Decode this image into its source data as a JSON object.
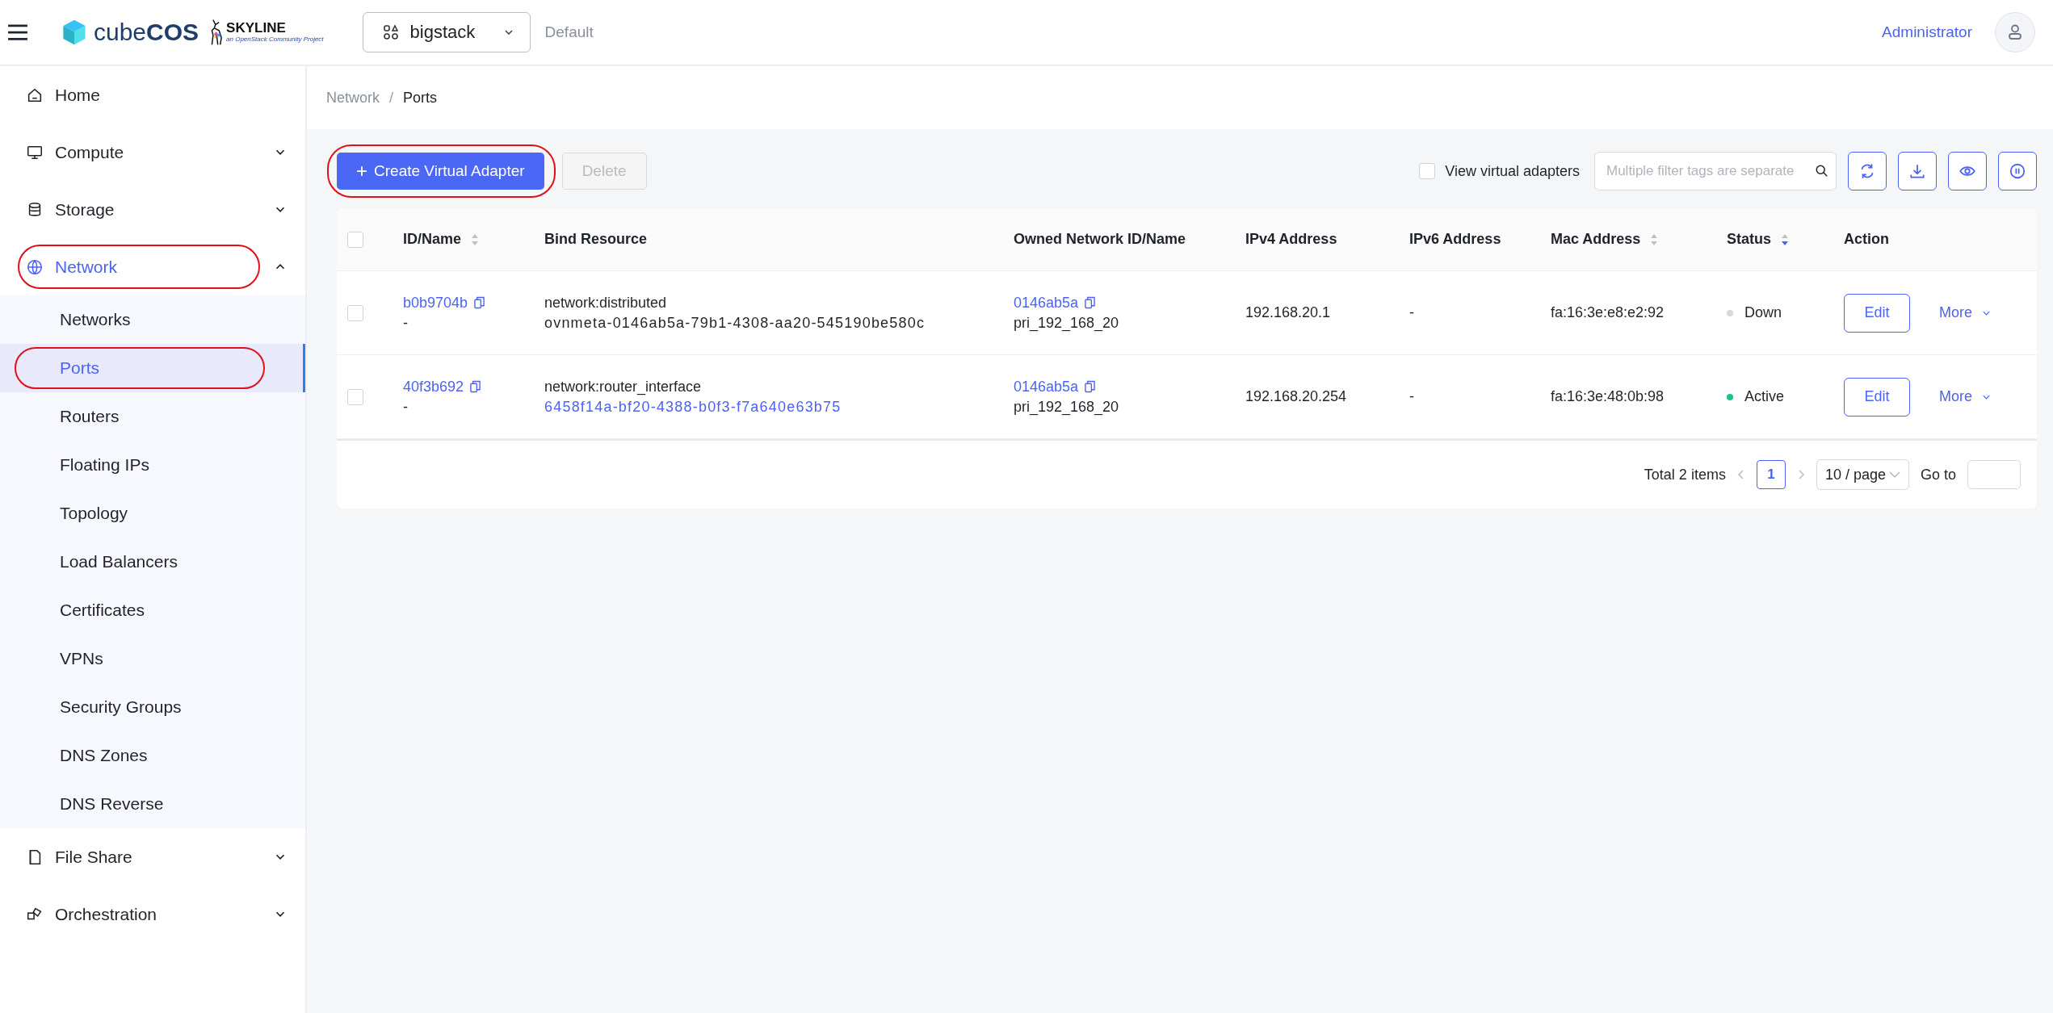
{
  "header": {
    "brand_light": "cube",
    "brand_bold": "COS",
    "partner": "SKYLINE",
    "partner_tagline": "an OpenStack Community Project",
    "project": "bigstack",
    "domain": "Default",
    "user": "Administrator"
  },
  "sidebar": {
    "items": [
      {
        "label": "Home",
        "kind": "home",
        "selected": false,
        "annotated": false
      },
      {
        "label": "Compute",
        "kind": "compute",
        "selected": false,
        "annotated": false,
        "expanded": false
      },
      {
        "label": "Storage",
        "kind": "storage",
        "selected": false,
        "annotated": false,
        "expanded": false
      },
      {
        "label": "Network",
        "kind": "network",
        "selected": true,
        "annotated": true,
        "expanded": true,
        "children": [
          {
            "label": "Networks",
            "selected": false,
            "annotated": false
          },
          {
            "label": "Ports",
            "selected": true,
            "annotated": true
          },
          {
            "label": "Routers",
            "selected": false,
            "annotated": false
          },
          {
            "label": "Floating IPs",
            "selected": false,
            "annotated": false
          },
          {
            "label": "Topology",
            "selected": false,
            "annotated": false
          },
          {
            "label": "Load Balancers",
            "selected": false,
            "annotated": false
          },
          {
            "label": "Certificates",
            "selected": false,
            "annotated": false
          },
          {
            "label": "VPNs",
            "selected": false,
            "annotated": false
          },
          {
            "label": "Security Groups",
            "selected": false,
            "annotated": false
          },
          {
            "label": "DNS Zones",
            "selected": false,
            "annotated": false
          },
          {
            "label": "DNS Reverse",
            "selected": false,
            "annotated": false
          }
        ]
      },
      {
        "label": "File Share",
        "kind": "file-share",
        "selected": false,
        "annotated": false,
        "expanded": false
      },
      {
        "label": "Orchestration",
        "kind": "orchestration",
        "selected": false,
        "annotated": false,
        "expanded": false
      }
    ]
  },
  "breadcrumb": {
    "separator": "/",
    "items": [
      "Network",
      "Ports"
    ]
  },
  "toolbar": {
    "create_button": {
      "icon": "+",
      "label": "Create Virtual Adapter",
      "annotated": true
    },
    "delete_button": {
      "label": "Delete",
      "disabled": true
    },
    "view_virtual": {
      "label": "View virtual adapters",
      "checked": false
    },
    "search": {
      "placeholder": "Multiple filter tags are separate"
    },
    "tools": [
      {
        "kind": "refresh"
      },
      {
        "kind": "download"
      },
      {
        "kind": "eye"
      },
      {
        "kind": "pause"
      }
    ]
  },
  "table": {
    "select_all": {
      "checked": false
    },
    "columns": [
      {
        "label": "ID/Name",
        "descending": false
      },
      {
        "label": "Bind Resource"
      },
      {
        "label": "Owned Network ID/Name"
      },
      {
        "label": "IPv4 Address"
      },
      {
        "label": "IPv6 Address"
      },
      {
        "label": "Mac Address",
        "descending": false
      },
      {
        "label": "Status",
        "descending": true
      },
      {
        "label": "Action"
      }
    ],
    "rows": [
      {
        "selected": false,
        "id": "b0b9704b",
        "name": "-",
        "bind_type": "network:distributed",
        "bind_resource": "ovnmeta-0146ab5a-79b1-4308-aa20-545190be580c",
        "bind_is_link": false,
        "network_id": "0146ab5a",
        "network_name": "pri_192_168_20",
        "ipv4": "192.168.20.1",
        "ipv6": "-",
        "mac": "fa:16:3e:e8:e2:92",
        "status": "Down",
        "color": "#d9d9d9",
        "edit": "Edit",
        "more": "More"
      },
      {
        "selected": false,
        "id": "40f3b692",
        "name": "-",
        "bind_type": "network:router_interface",
        "bind_resource": "6458f14a-bf20-4388-b0f3-f7a640e63b75",
        "bind_is_link": true,
        "network_id": "0146ab5a",
        "network_name": "pri_192_168_20",
        "ipv4": "192.168.20.254",
        "ipv6": "-",
        "mac": "fa:16:3e:48:0b:98",
        "status": "Active",
        "color": "#19c28e",
        "edit": "Edit",
        "more": "More"
      }
    ]
  },
  "pagination": {
    "total": "Total 2 items",
    "pages": [
      {
        "label": "1",
        "selected": true
      }
    ],
    "page_size": "10 / page",
    "goto": "Go to"
  }
}
